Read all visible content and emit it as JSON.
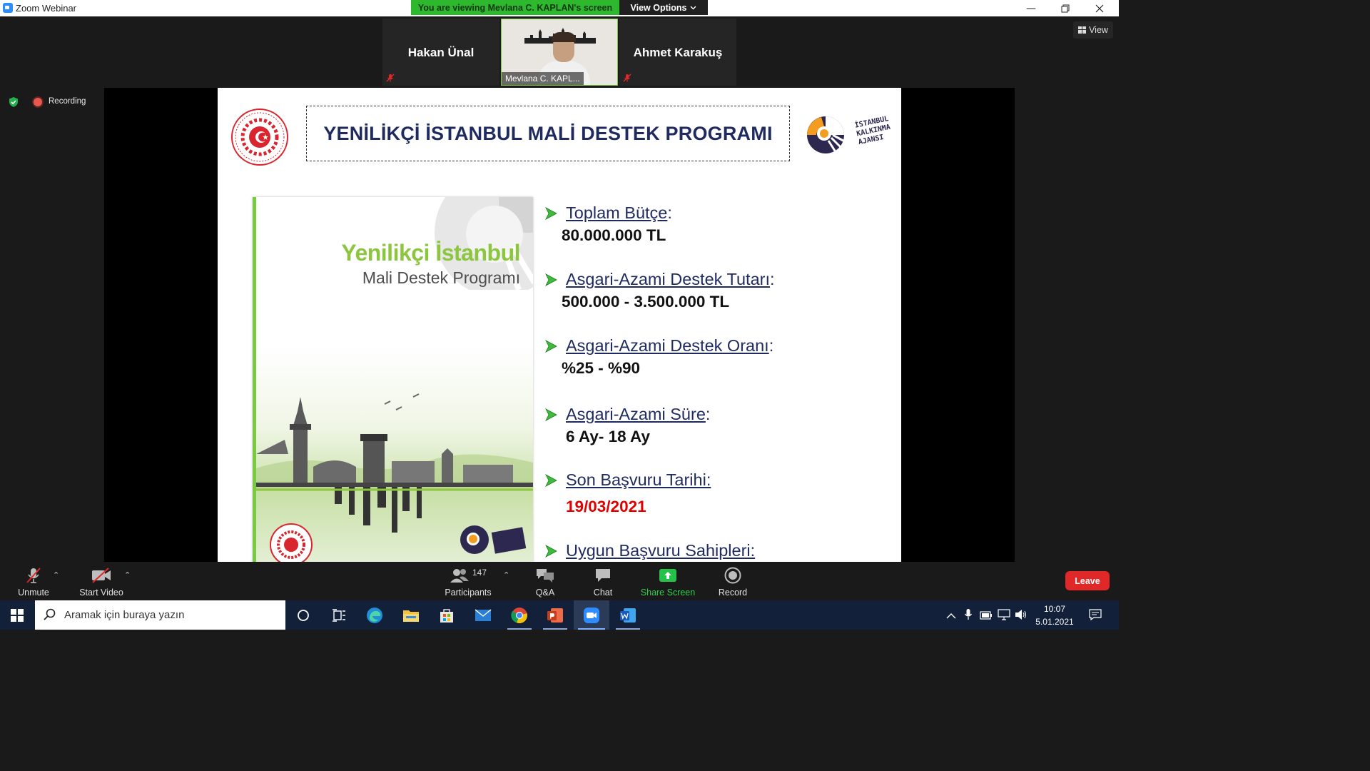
{
  "window": {
    "title": "Zoom Webinar"
  },
  "banner": {
    "viewing_text": "You are viewing Mevlana C. KAPLAN's screen",
    "view_options_label": "View Options"
  },
  "participants_strip": {
    "left_name": "Hakan Ünal",
    "video_label": "Mevlana C. KAPL...",
    "right_name": "Ahmet Karakuş"
  },
  "view_button_label": "View",
  "recording_label": "Recording",
  "slide": {
    "title": "YENİLİKÇİ İSTANBUL MALİ DESTEK PROGRAMI",
    "agency_logo_text": [
      "İSTANBUL",
      "KALKINMA",
      "AJANSI"
    ],
    "brochure": {
      "title_line1": "Yenilikçi İstanbul",
      "title_line2": "Mali Destek Programı"
    },
    "bullets": [
      {
        "label": "Toplam Bütçe",
        "suffix": ":",
        "value": "80.000.000 TL"
      },
      {
        "label": "Asgari-Azami Destek Tutarı",
        "suffix": ":",
        "value": "500.000 - 3.500.000 TL"
      },
      {
        "label": "Asgari-Azami Destek Oranı",
        "suffix": ":",
        "value": "%25 - %90"
      },
      {
        "label": "Asgari-Azami Süre",
        "suffix": ":",
        "value": "6 Ay- 18 Ay"
      },
      {
        "label": "Son Başvuru Tarihi:",
        "suffix": "",
        "value": "19/03/2021"
      },
      {
        "label": "Uygun Başvuru Sahipleri:",
        "suffix": "",
        "value": ""
      }
    ]
  },
  "toolbar": {
    "unmute": "Unmute",
    "start_video": "Start Video",
    "participants": "Participants",
    "participants_count": "147",
    "qa": "Q&A",
    "chat": "Chat",
    "share_screen": "Share Screen",
    "record": "Record",
    "leave": "Leave"
  },
  "taskbar": {
    "search_placeholder": "Aramak için buraya yazın",
    "time": "10:07",
    "date": "5.01.2021"
  },
  "colors": {
    "share_green": "#2eb82e",
    "slide_navy": "#1f2a5e",
    "deadline_red": "#e00000",
    "leave_red": "#e02828",
    "brochure_green": "#8cc63f"
  }
}
